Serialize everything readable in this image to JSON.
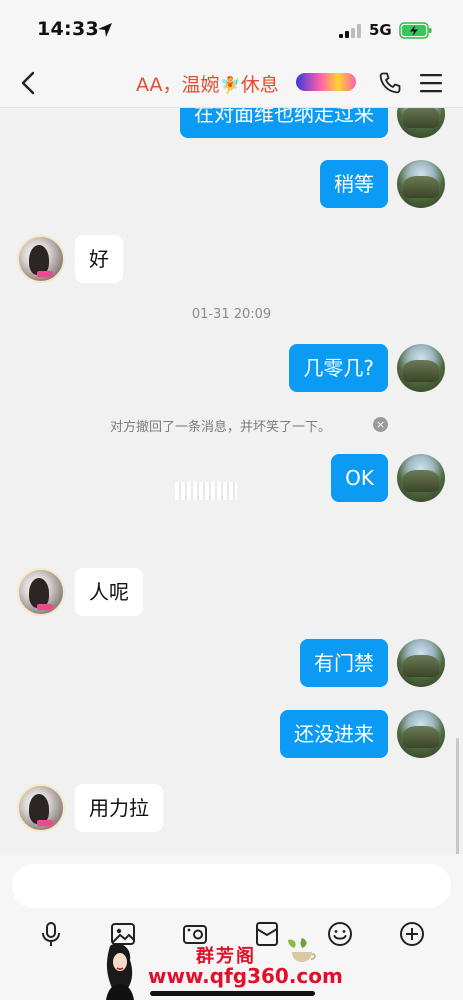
{
  "status_bar": {
    "time": "14:33",
    "network": "5G"
  },
  "header": {
    "title": "AA，温婉",
    "fairy": "🧚",
    "title_suffix": "休息"
  },
  "messages": [
    {
      "side": "me",
      "text": "在对面维也纳走过来"
    },
    {
      "side": "me",
      "text": "稍等"
    },
    {
      "side": "other",
      "text": "好"
    },
    {
      "side": "me",
      "text": "几零几?"
    },
    {
      "side": "me",
      "text": "OK"
    },
    {
      "side": "other",
      "text": "人呢"
    },
    {
      "side": "me",
      "text": "有门禁"
    },
    {
      "side": "me",
      "text": "还没进来"
    },
    {
      "side": "other",
      "text": "用力拉"
    }
  ],
  "system": {
    "timestamp": "01-31 20:09",
    "recall_notice": "对方撤回了一条消息，并坏笑了一下。",
    "recall_close": "×"
  },
  "input": {
    "placeholder": ""
  },
  "watermark": {
    "name": "群芳阁",
    "url": "www.qfg360.com"
  },
  "colors": {
    "my_bubble": "#0b9bf4",
    "other_bubble": "#ffffff",
    "title": "#e54d2e",
    "watermark": "#e0102a"
  }
}
